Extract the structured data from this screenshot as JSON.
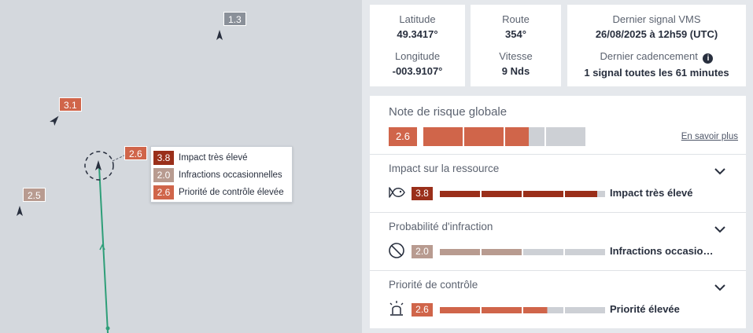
{
  "map": {
    "vessel_tags": [
      {
        "id": "v1",
        "score": "1.3",
        "color": "#8a9099"
      },
      {
        "id": "v2",
        "score": "3.1",
        "color": "#d0654a"
      },
      {
        "id": "v3",
        "score": "2.6",
        "color": "#d0654a"
      },
      {
        "id": "v4",
        "score": "2.5",
        "color": "#b89b90"
      }
    ],
    "tooltip": {
      "rows": [
        {
          "score": "3.8",
          "label": "Impact très élevé",
          "color": "#9a2f1a"
        },
        {
          "score": "2.0",
          "label": "Infractions occasionnelles",
          "color": "#b89b90"
        },
        {
          "score": "2.6",
          "label": "Priorité de contrôle élevée",
          "color": "#d0654a"
        }
      ]
    },
    "track_color": "#2e9e78"
  },
  "position": {
    "latitude_label": "Latitude",
    "latitude_value": "49.3417°",
    "longitude_label": "Longitude",
    "longitude_value": "-003.9107°"
  },
  "movement": {
    "route_label": "Route",
    "route_value": "354°",
    "speed_label": "Vitesse",
    "speed_value": "9 Nds"
  },
  "vms": {
    "last_signal_label": "Dernier signal VMS",
    "last_signal_value": "26/08/2025 à 12h59 (UTC)",
    "cadence_label": "Dernier cadencement",
    "cadence_value": "1 signal toutes les 61 minutes",
    "info_icon": "info-icon"
  },
  "global_risk": {
    "title": "Note de risque globale",
    "score": "2.6",
    "score_value": 2.6,
    "max": 4,
    "color": "#d0654a",
    "empty_color": "#cdd0d5",
    "learn_more": "En savoir plus"
  },
  "sections": [
    {
      "title": "Impact sur la ressource",
      "icon": "fish-icon",
      "score": "3.8",
      "score_value": 3.8,
      "color": "#9a2f1a",
      "level": "Impact très élevé",
      "chevron": "chevron-down-icon"
    },
    {
      "title": "Probabilité d'infraction",
      "icon": "prohibited-icon",
      "score": "2.0",
      "score_value": 2.0,
      "color": "#b89b90",
      "level": "Infractions occasio…",
      "chevron": "chevron-down-icon"
    },
    {
      "title": "Priorité de contrôle",
      "icon": "siren-icon",
      "score": "2.6",
      "score_value": 2.6,
      "color": "#d0654a",
      "level": "Priorité élevée",
      "chevron": "chevron-down-icon"
    }
  ]
}
